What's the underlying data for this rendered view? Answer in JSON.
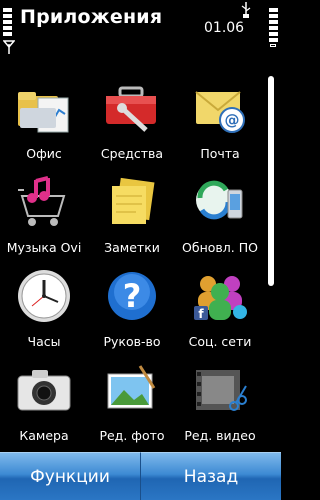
{
  "header": {
    "title": "Приложения",
    "clock": "01.06"
  },
  "apps": [
    {
      "label": "Офис",
      "icon": "office-folder-icon"
    },
    {
      "label": "Средства",
      "icon": "toolbox-icon"
    },
    {
      "label": "Почта",
      "icon": "mail-icon"
    },
    {
      "label": "Музыка Ovi",
      "icon": "music-cart-icon"
    },
    {
      "label": "Заметки",
      "icon": "notes-icon"
    },
    {
      "label": "Обновл. ПО",
      "icon": "software-update-icon"
    },
    {
      "label": "Часы",
      "icon": "clock-icon"
    },
    {
      "label": "Руков-во",
      "icon": "help-icon"
    },
    {
      "label": "Соц. сети",
      "icon": "social-networks-icon"
    },
    {
      "label": "Камера",
      "icon": "camera-icon"
    },
    {
      "label": "Ред. фото",
      "icon": "photo-editor-icon"
    },
    {
      "label": "Ред. видео",
      "icon": "video-editor-icon"
    }
  ],
  "softkeys": {
    "left": "Функции",
    "right": "Назад"
  }
}
